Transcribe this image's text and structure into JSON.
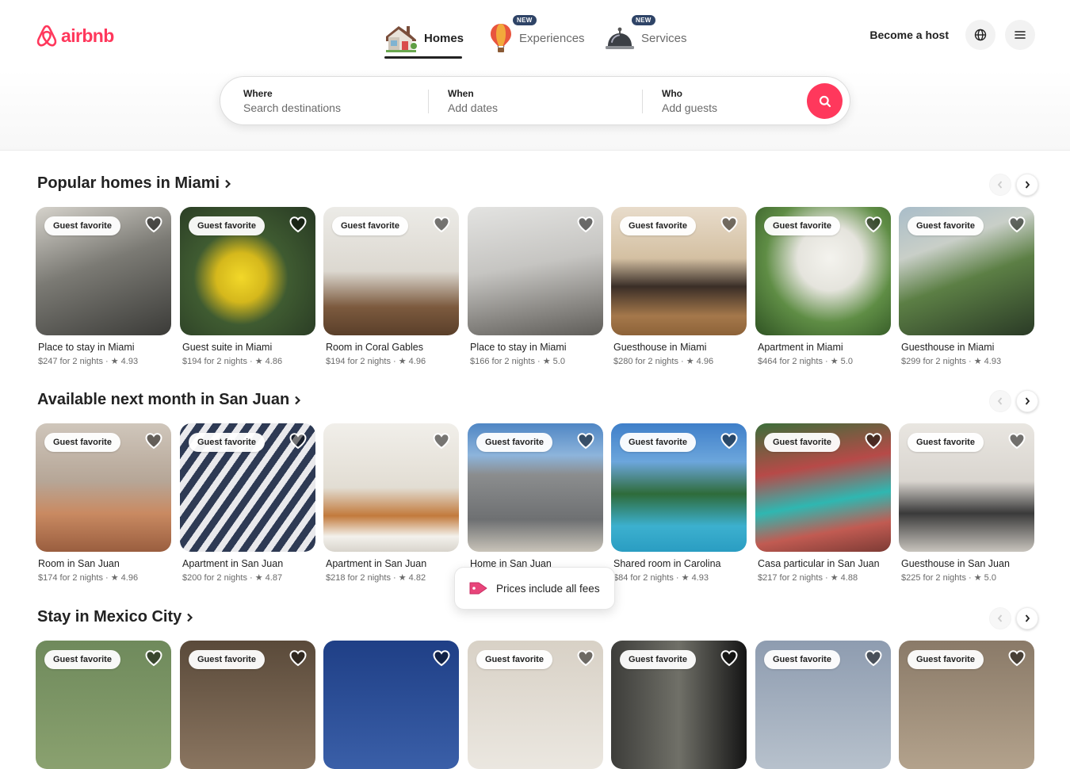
{
  "brand": {
    "name": "airbnb",
    "color": "#ff385c"
  },
  "nav": {
    "tabs": [
      {
        "label": "Homes",
        "icon": "house-icon",
        "active": true
      },
      {
        "label": "Experiences",
        "icon": "hot-air-balloon-icon",
        "badge": "NEW"
      },
      {
        "label": "Services",
        "icon": "service-bell-icon",
        "badge": "NEW"
      }
    ]
  },
  "header_right": {
    "host_label": "Become a host",
    "globe_icon": "globe-icon",
    "menu_icon": "menu-icon"
  },
  "search": {
    "where": {
      "label": "Where",
      "placeholder": "Search destinations"
    },
    "when": {
      "label": "When",
      "placeholder": "Add dates"
    },
    "who": {
      "label": "Who",
      "placeholder": "Add guests"
    },
    "button_icon": "search-icon"
  },
  "sections": [
    {
      "title": "Popular homes in Miami",
      "listings": [
        {
          "badge": "Guest favorite",
          "title": "Place to stay in Miami",
          "price": "$247 for 2 nights",
          "rating": "4.93"
        },
        {
          "badge": "Guest favorite",
          "title": "Guest suite in Miami",
          "price": "$194 for 2 nights",
          "rating": "4.86"
        },
        {
          "badge": "Guest favorite",
          "title": "Room in Coral Gables",
          "price": "$194 for 2 nights",
          "rating": "4.96"
        },
        {
          "badge": "",
          "title": "Place to stay in Miami",
          "price": "$166 for 2 nights",
          "rating": "5.0"
        },
        {
          "badge": "Guest favorite",
          "title": "Guesthouse in Miami",
          "price": "$280 for 2 nights",
          "rating": "4.96"
        },
        {
          "badge": "Guest favorite",
          "title": "Apartment in Miami",
          "price": "$464 for 2 nights",
          "rating": "5.0"
        },
        {
          "badge": "Guest favorite",
          "title": "Guesthouse in Miami",
          "price": "$299 for 2 nights",
          "rating": "4.93"
        }
      ]
    },
    {
      "title": "Available next month in San Juan",
      "listings": [
        {
          "badge": "Guest favorite",
          "title": "Room in San Juan",
          "price": "$174 for 2 nights",
          "rating": "4.96"
        },
        {
          "badge": "Guest favorite",
          "title": "Apartment in San Juan",
          "price": "$200 for 2 nights",
          "rating": "4.87"
        },
        {
          "badge": "",
          "title": "Apartment in San Juan",
          "price": "$218 for 2 nights",
          "rating": "4.82"
        },
        {
          "badge": "Guest favorite",
          "title": "Home in San Juan",
          "price": "",
          "rating": ""
        },
        {
          "badge": "Guest favorite",
          "title": "Shared room in Carolina",
          "price": "$84 for 2 nights",
          "rating": "4.93"
        },
        {
          "badge": "Guest favorite",
          "title": "Casa particular in San Juan",
          "price": "$217 for 2 nights",
          "rating": "4.88"
        },
        {
          "badge": "Guest favorite",
          "title": "Guesthouse in San Juan",
          "price": "$225 for 2 nights",
          "rating": "5.0"
        }
      ]
    },
    {
      "title": "Stay in Mexico City",
      "listings": [
        {
          "badge": "Guest favorite",
          "title": "",
          "price": "",
          "rating": ""
        },
        {
          "badge": "Guest favorite",
          "title": "",
          "price": "",
          "rating": ""
        },
        {
          "badge": "",
          "title": "",
          "price": "",
          "rating": ""
        },
        {
          "badge": "Guest favorite",
          "title": "",
          "price": "",
          "rating": ""
        },
        {
          "badge": "Guest favorite",
          "title": "",
          "price": "",
          "rating": ""
        },
        {
          "badge": "Guest favorite",
          "title": "",
          "price": "",
          "rating": ""
        },
        {
          "badge": "Guest favorite",
          "title": "",
          "price": "",
          "rating": ""
        }
      ]
    }
  ],
  "toast": {
    "text": "Prices include all fees",
    "icon": "price-tag-icon"
  }
}
